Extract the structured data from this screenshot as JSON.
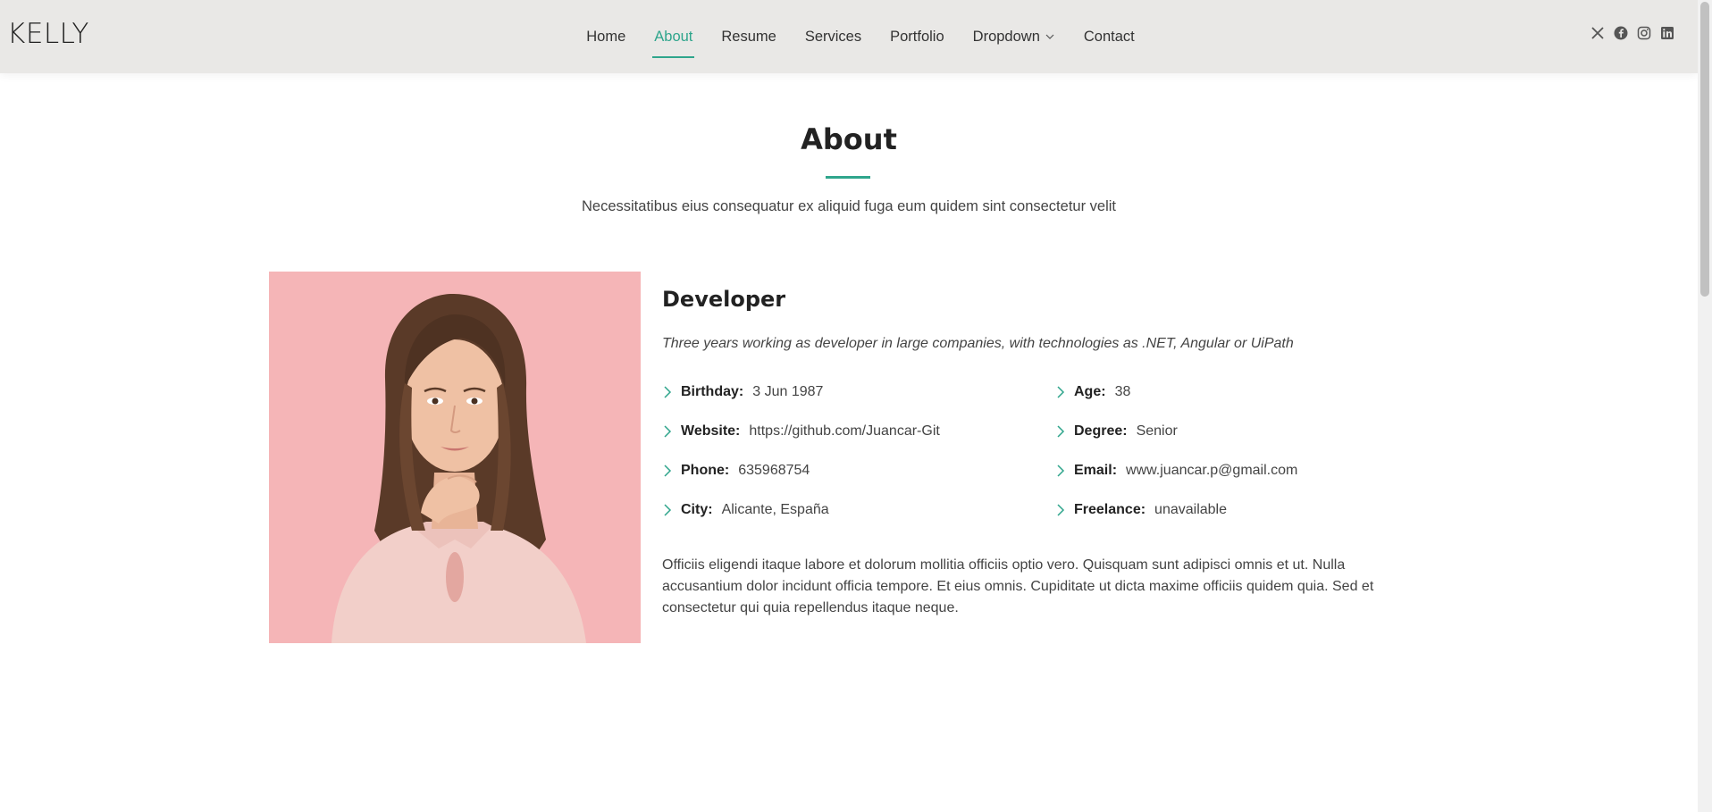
{
  "header": {
    "logo": "KELLY",
    "nav": [
      {
        "label": "Home",
        "active": false
      },
      {
        "label": "About",
        "active": true
      },
      {
        "label": "Resume",
        "active": false
      },
      {
        "label": "Services",
        "active": false
      },
      {
        "label": "Portfolio",
        "active": false
      },
      {
        "label": "Dropdown",
        "active": false,
        "has_dropdown": true
      },
      {
        "label": "Contact",
        "active": false
      }
    ],
    "social_icons": [
      "x-icon",
      "facebook-icon",
      "instagram-icon",
      "linkedin-icon"
    ]
  },
  "about": {
    "title": "About",
    "subtitle": "Necessitatibus eius consequatur ex aliquid fuga eum quidem sint consectetur velit",
    "role": "Developer",
    "tagline": "Three years working as developer in large companies, with technologies as .NET, Angular or UiPath",
    "info_left": [
      {
        "key": "Birthday:",
        "value": "3 Jun 1987"
      },
      {
        "key": "Website:",
        "value": "https://github.com/Juancar-Git"
      },
      {
        "key": "Phone:",
        "value": "635968754"
      },
      {
        "key": "City:",
        "value": "Alicante, España"
      }
    ],
    "info_right": [
      {
        "key": "Age:",
        "value": "38"
      },
      {
        "key": "Degree:",
        "value": "Senior"
      },
      {
        "key": "Email:",
        "value": "www.juancar.p@gmail.com"
      },
      {
        "key": "Freelance:",
        "value": "unavailable"
      }
    ],
    "description": "Officiis eligendi itaque labore et dolorum mollitia officiis optio vero. Quisquam sunt adipisci omnis et ut. Nulla accusantium dolor incidunt officia tempore. Et eius omnis. Cupiditate ut dicta maxime officiis quidem quia. Sed et consectetur qui quia repellendus itaque neque."
  },
  "colors": {
    "accent": "#2fa58c",
    "header_bg": "#e9e8e6",
    "photo_bg": "#f5b5b7"
  }
}
